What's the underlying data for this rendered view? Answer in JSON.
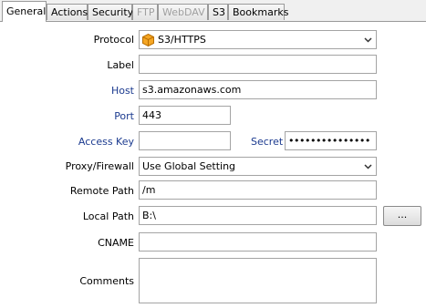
{
  "tabs": [
    "General",
    "Actions",
    "Security",
    "FTP",
    "WebDAV",
    "S3",
    "Bookmarks"
  ],
  "form": {
    "protocol": {
      "label": "Protocol",
      "value": "S3/HTTPS",
      "icon": "amazon-s3-cube-icon"
    },
    "label": {
      "label": "Label",
      "value": ""
    },
    "host": {
      "label": "Host",
      "value": "s3.amazonaws.com"
    },
    "port": {
      "label": "Port",
      "value": "443"
    },
    "access_key": {
      "label": "Access Key",
      "value": ""
    },
    "secret": {
      "label": "Secret",
      "value": "•••••••••••••••"
    },
    "proxy": {
      "label": "Proxy/Firewall",
      "value": "Use Global Setting"
    },
    "remote_path": {
      "label": "Remote Path",
      "value": "/m"
    },
    "local_path": {
      "label": "Local Path",
      "value": "B:\\"
    },
    "browse_label": "...",
    "cname": {
      "label": "CNAME",
      "value": ""
    },
    "comments": {
      "label": "Comments",
      "value": ""
    }
  },
  "colors": {
    "required_label": "#1b3a8f",
    "s3_icon": "#f5a623"
  }
}
